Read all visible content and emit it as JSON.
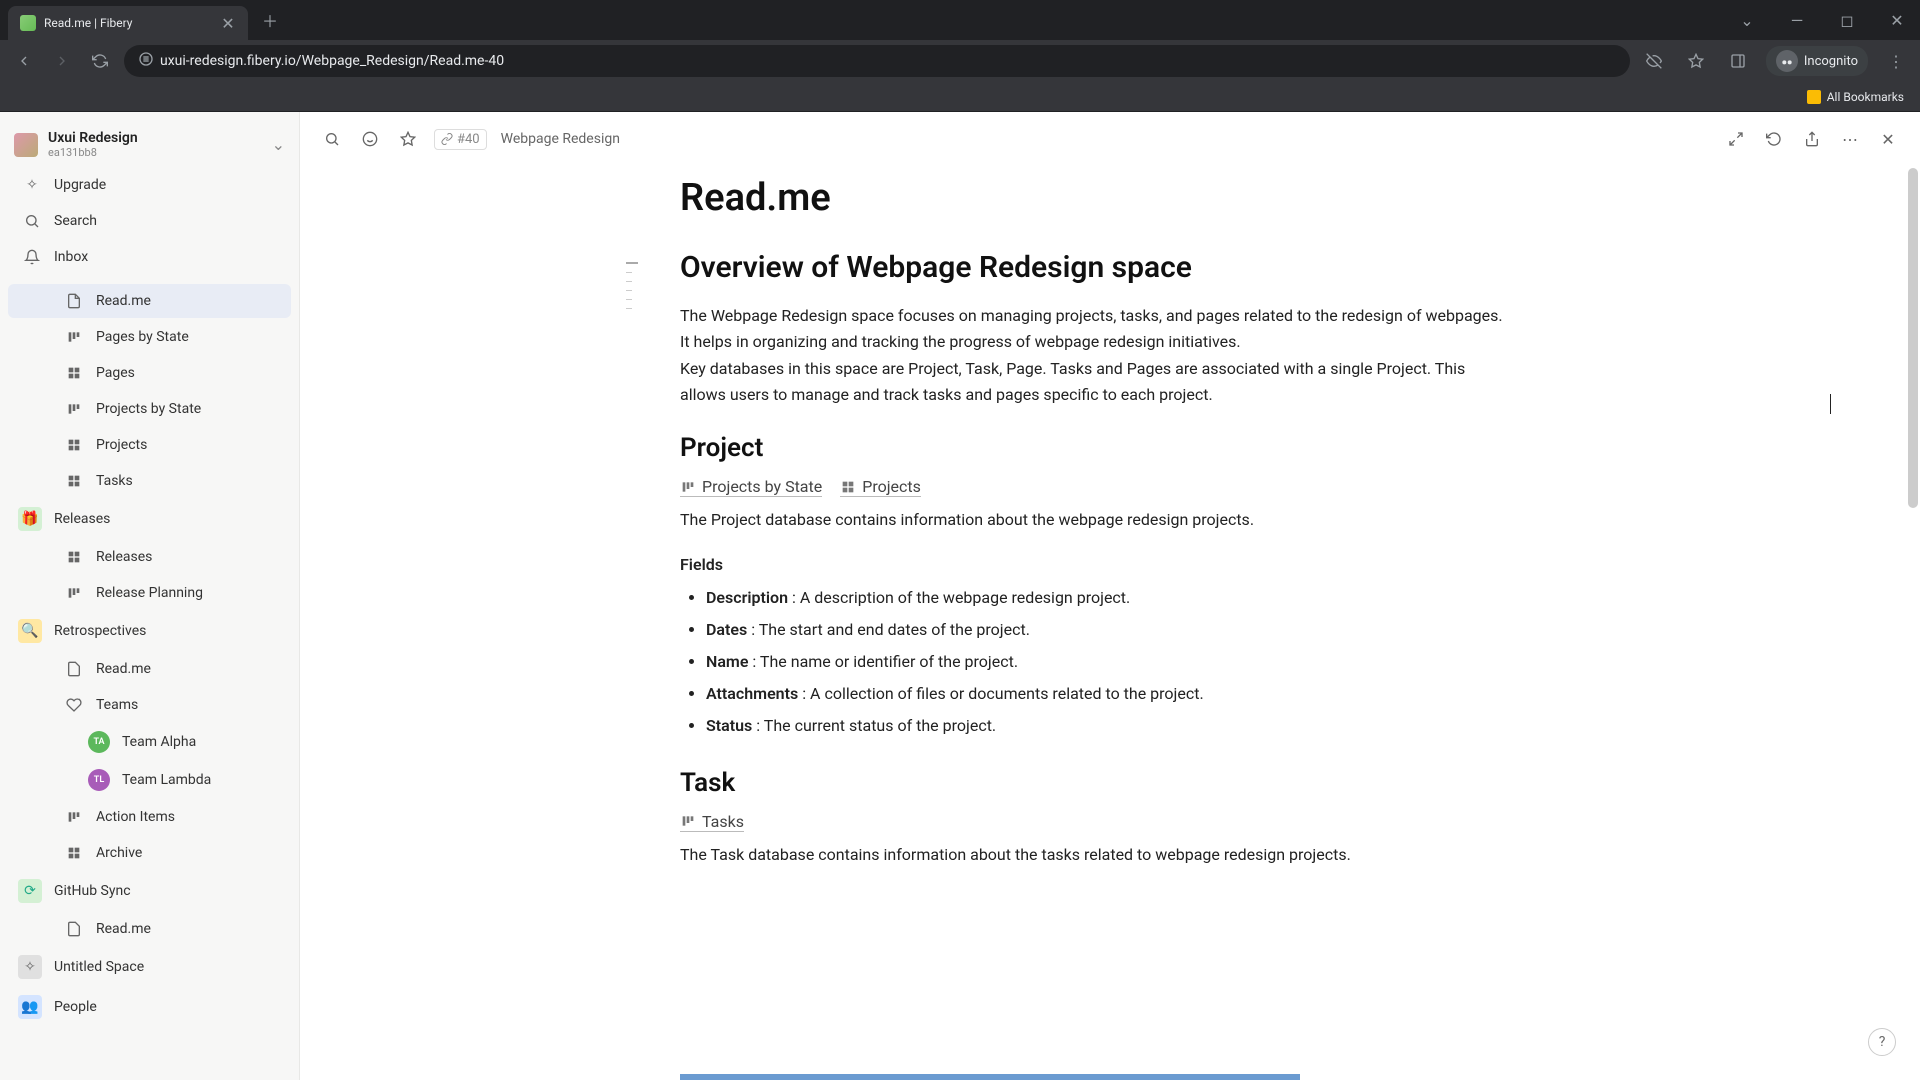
{
  "browser": {
    "tab_title": "Read.me | Fibery",
    "url": "uxui-redesign.fibery.io/Webpage_Redesign/Read.me-40",
    "incognito_label": "Incognito",
    "bookmarks_label": "All Bookmarks"
  },
  "workspace": {
    "name": "Uxui Redesign",
    "id": "ea131bb8"
  },
  "sidebar": {
    "upgrade": "Upgrade",
    "search": "Search",
    "inbox": "Inbox",
    "items": [
      {
        "label": "Read.me",
        "icon": "doc",
        "active": true
      },
      {
        "label": "Pages by State",
        "icon": "board"
      },
      {
        "label": "Pages",
        "icon": "grid"
      },
      {
        "label": "Projects by State",
        "icon": "board"
      },
      {
        "label": "Projects",
        "icon": "grid"
      },
      {
        "label": "Tasks",
        "icon": "grid"
      }
    ],
    "spaces": [
      {
        "label": "Releases",
        "color": "green",
        "children": [
          {
            "label": "Releases",
            "icon": "grid"
          },
          {
            "label": "Release Planning",
            "icon": "board"
          }
        ]
      },
      {
        "label": "Retrospectives",
        "color": "yellow",
        "children": [
          {
            "label": "Read.me",
            "icon": "doc"
          },
          {
            "label": "Teams",
            "icon": "heart",
            "children": [
              {
                "label": "Team Alpha",
                "badge": "TA",
                "badge_color": "green"
              },
              {
                "label": "Team Lambda",
                "badge": "TL",
                "badge_color": "purple"
              }
            ]
          },
          {
            "label": "Action Items",
            "icon": "board"
          },
          {
            "label": "Archive",
            "icon": "grid"
          }
        ]
      },
      {
        "label": "GitHub Sync",
        "color": "green",
        "children": [
          {
            "label": "Read.me",
            "icon": "doc"
          }
        ]
      },
      {
        "label": "Untitled Space",
        "color": "gray"
      },
      {
        "label": "People",
        "color": "blue"
      }
    ]
  },
  "toolbar": {
    "entity_id": "#40",
    "breadcrumb": "Webpage Redesign"
  },
  "doc": {
    "title": "Read.me",
    "h2": "Overview of Webpage Redesign space",
    "p1": "The Webpage Redesign space focuses on managing projects, tasks, and pages related to the redesign of webpages. It helps in organizing and tracking the progress of webpage redesign initiatives.",
    "p2": "Key databases in this space are Project, Task, Page. Tasks and Pages are associated with a single Project. This allows users to manage and track tasks and pages specific to each project.",
    "project": {
      "heading": "Project",
      "links": [
        {
          "label": "Projects by State",
          "icon": "board"
        },
        {
          "label": "Projects",
          "icon": "grid"
        }
      ],
      "desc": "The Project database contains information about the webpage redesign projects.",
      "fields_label": "Fields",
      "fields": [
        {
          "name": "Description",
          "desc": ": A description of the webpage redesign project."
        },
        {
          "name": "Dates",
          "desc": ": The start and end dates of the project."
        },
        {
          "name": "Name",
          "desc": ": The name or identifier of the project."
        },
        {
          "name": "Attachments",
          "desc": ": A collection of files or documents related to the project."
        },
        {
          "name": "Status",
          "desc": ": The current status of the project."
        }
      ]
    },
    "task": {
      "heading": "Task",
      "links": [
        {
          "label": "Tasks",
          "icon": "board"
        }
      ],
      "desc": "The Task database contains information about the tasks related to webpage redesign projects."
    }
  }
}
